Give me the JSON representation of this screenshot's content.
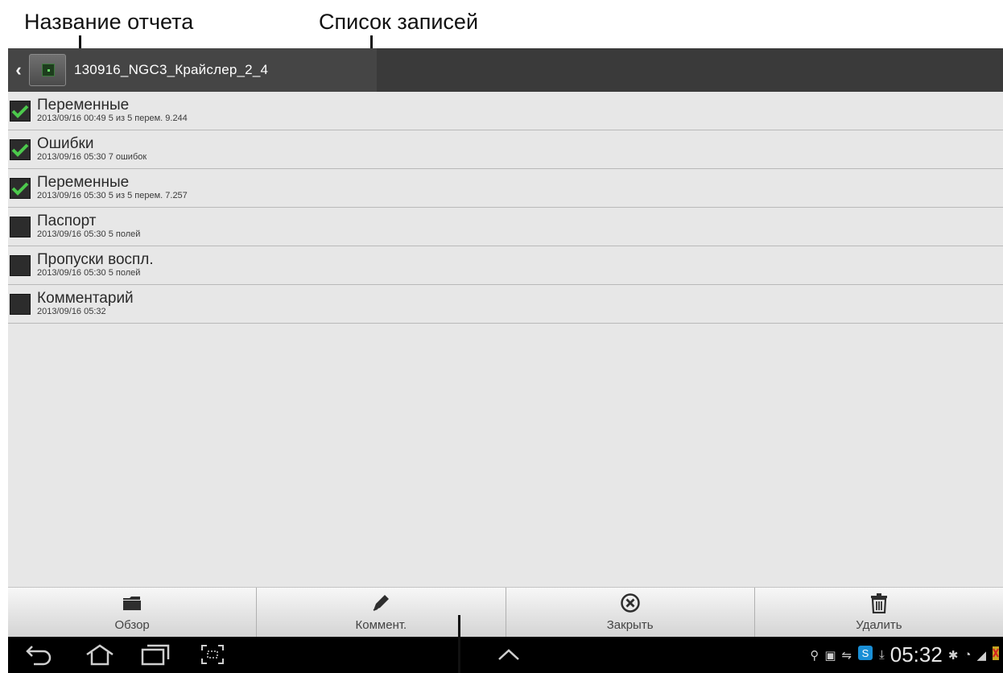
{
  "callouts": {
    "report_name": "Название отчета",
    "record_list": "Список записей"
  },
  "action_bar": {
    "title": "130916_NGC3_Крайслер_2_4"
  },
  "records": [
    {
      "title": "Переменные",
      "meta": "2013/09/16 00:49  5 из 5 перем. 9.244",
      "checked": true
    },
    {
      "title": "Ошибки",
      "meta": "2013/09/16 05:30  7 ошибок",
      "checked": true
    },
    {
      "title": "Переменные",
      "meta": "2013/09/16 05:30  5 из 5 перем. 7.257",
      "checked": true
    },
    {
      "title": "Паспорт",
      "meta": "2013/09/16 05:30  5 полей",
      "checked": false
    },
    {
      "title": "Пропуски воспл.",
      "meta": "2013/09/16 05:30  5 полей",
      "checked": false
    },
    {
      "title": "Комментарий",
      "meta": "2013/09/16 05:32",
      "checked": false
    }
  ],
  "toolbar": {
    "browse_label": "Обзор",
    "comment_label": "Коммент.",
    "close_label": "Закрыть",
    "delete_label": "Удалить"
  },
  "status_bar": {
    "time": "05:32"
  },
  "colors": {
    "check_green": "#4cc94c",
    "action_bar": "#3a3a3a",
    "list_bg": "#e7e7e7"
  }
}
